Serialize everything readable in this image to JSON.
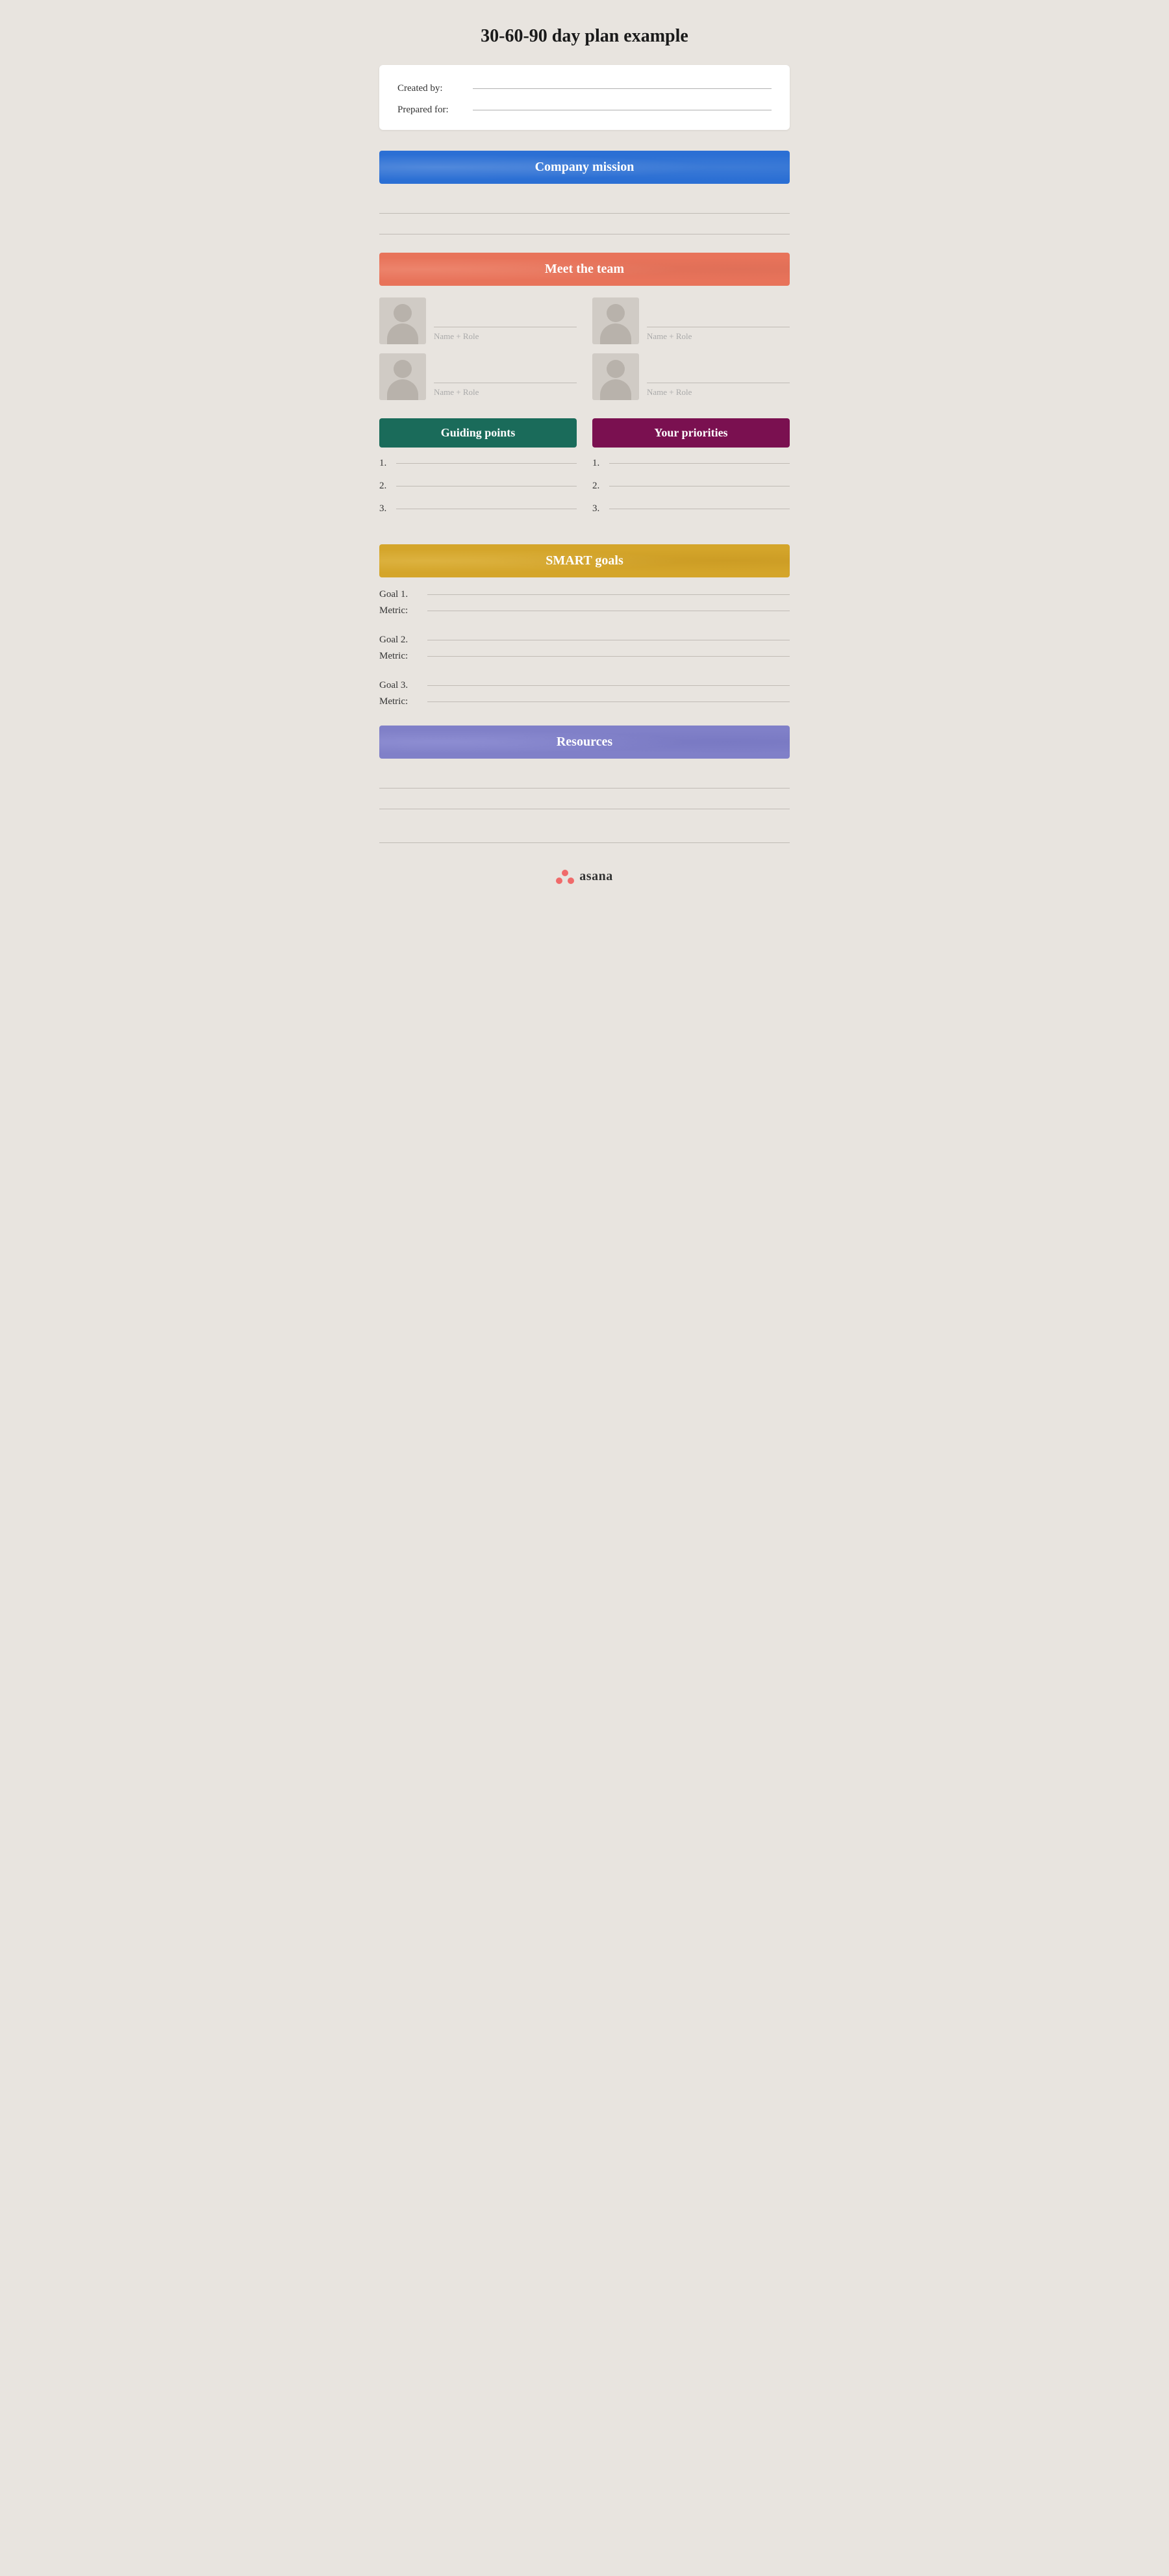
{
  "page": {
    "title": "30-60-90 day plan example"
  },
  "info_box": {
    "created_by_label": "Created by:",
    "prepared_for_label": "Prepared for:"
  },
  "company_mission": {
    "banner_label": "Company mission"
  },
  "meet_the_team": {
    "banner_label": "Meet the team",
    "members": [
      {
        "name_label": "Name + Role"
      },
      {
        "name_label": "Name + Role"
      },
      {
        "name_label": "Name + Role"
      },
      {
        "name_label": "Name + Role"
      }
    ]
  },
  "guiding_points": {
    "banner_label": "Guiding points",
    "items": [
      "1.",
      "2.",
      "3."
    ]
  },
  "your_priorities": {
    "banner_label": "Your priorities",
    "items": [
      "1.",
      "2.",
      "3."
    ]
  },
  "smart_goals": {
    "banner_label": "SMART goals",
    "goals": [
      {
        "goal_label": "Goal 1.",
        "metric_label": "Metric:"
      },
      {
        "goal_label": "Goal 2.",
        "metric_label": "Metric:"
      },
      {
        "goal_label": "Goal 3.",
        "metric_label": "Metric:"
      }
    ]
  },
  "resources": {
    "banner_label": "Resources"
  },
  "footer": {
    "brand_name": "asana"
  }
}
